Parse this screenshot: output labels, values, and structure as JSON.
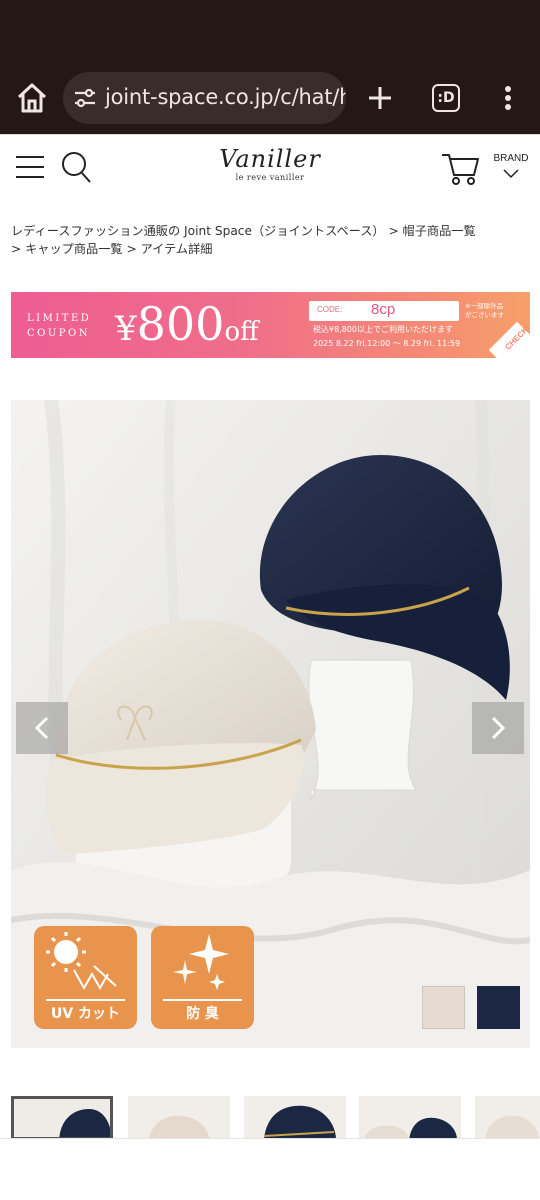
{
  "browser": {
    "url": "joint-space.co.jp/c/hat/h",
    "tabs_icon": ":D"
  },
  "header": {
    "logo_main": "Vaniller",
    "logo_sub": "le reve vaniller",
    "brand_label": "BRAND"
  },
  "breadcrumb": {
    "line1": "レディースファッション通販の Joint Space（ジョイントスペース） > 帽子商品一覧",
    "line2": "> キャップ商品一覧 > アイテム詳細"
  },
  "coupon": {
    "limited_line1": "LIMITED",
    "limited_line2": "COUPON",
    "yen": "¥",
    "amount": "800",
    "off": "off",
    "code_label": "CODE:",
    "code_value": "8cp",
    "condition": "税込¥8,800以上でご利用いただけます",
    "date": "2025 8.22 fri.12:00 ～ 8.29 fri. 11:59",
    "note_line1": "※一部除外品",
    "note_line2": "がございます",
    "check": "CHECK!"
  },
  "product": {
    "badges": [
      {
        "icon": "uv-sun-icon",
        "label": "UV カット"
      },
      {
        "icon": "sparkle-icon",
        "label": "防 臭"
      }
    ],
    "swatches": [
      {
        "name": "beige",
        "color": "#e6dbd2"
      },
      {
        "name": "navy",
        "color": "#1c2744"
      }
    ]
  },
  "colors": {
    "browser_bg": "#231816",
    "coupon_pink": "#ee5d92",
    "coupon_orange": "#f7a06a",
    "badge_orange": "#e8944c"
  }
}
